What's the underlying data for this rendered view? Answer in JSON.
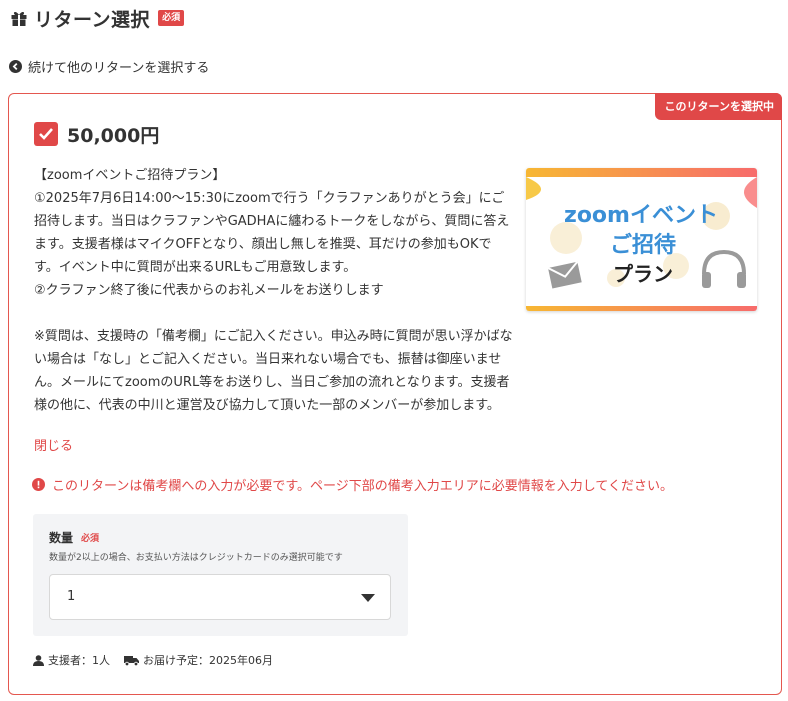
{
  "header": {
    "title": "リターン選択",
    "required_badge": "必須"
  },
  "back_link": {
    "label": "続けて他のリターンを選択する"
  },
  "card": {
    "selected_badge": "このリターンを選択中",
    "checked": true,
    "price": "50,000円",
    "description": {
      "paragraph1": "【zoomイベントご招待プラン】\n①2025年7月6日14:00～15:30にzoomで行う「クラファンありがとう会」にご招待します。当日はクラファンやGADHAに纏わるトークをしながら、質問に答えます。支援者様はマイクOFFとなり、顔出し無しを推奨、耳だけの参加もOKです。イベント中に質問が出来るURLもご用意致します。\n②クラファン終了後に代表からのお礼メールをお送りします",
      "paragraph2": "※質問は、支援時の「備考欄」にご記入ください。申込み時に質問が思い浮かばない場合は「なし」とご記入ください。当日来れない場合でも、振替は御座いません。メールにてzoomのURL等をお送りし、当日ご参加の流れとなります。支援者様の他に、代表の中川と運営及び協力して頂いた一部のメンバーが参加します。"
    },
    "close_label": "閉じる",
    "image": {
      "line1": "zoomイベント",
      "line2": "ご招待",
      "line3": "プラン"
    },
    "warning": "このリターンは備考欄への入力が必要です。ページ下部の備考入力エリアに必要情報を入力してください。",
    "quantity": {
      "label": "数量",
      "required": "必須",
      "note": "数量が2以上の場合、お支払い方法はクレジットカードのみ選択可能です",
      "value": "1"
    },
    "meta": {
      "supporters": "支援者：1人",
      "delivery": "お届け予定：2025年06月"
    }
  },
  "colors": {
    "accent": "#e04848",
    "panel": "#f3f4f6",
    "promo_blue": "#3a8fd6"
  }
}
